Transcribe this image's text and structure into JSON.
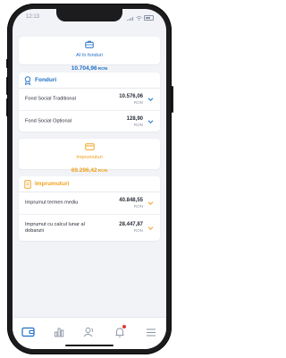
{
  "colors": {
    "blue": "#1f6fc5",
    "orange": "#f0a21e",
    "red": "#e53935",
    "text": "#2a2f3a",
    "muted": "#8a93a6"
  },
  "status": {
    "time": "12:13"
  },
  "fund_summary": {
    "label": "AI în fonduri",
    "amount": "10.704,96",
    "currency": "RON",
    "icon": "briefcase-icon"
  },
  "funds": {
    "title": "Fonduri",
    "icon": "ribbon-badge-icon",
    "rows": [
      {
        "name": "Fond Social Traditional",
        "amount": "10.576,06",
        "currency": "RON"
      },
      {
        "name": "Fond Social Optional",
        "amount": "128,90",
        "currency": "RON"
      }
    ]
  },
  "loan_summary": {
    "label": "Imprumuturi",
    "amount": "69.296,42",
    "currency": "RON",
    "icon": "wallet-card-icon"
  },
  "loans": {
    "title": "Imprumuturi",
    "icon": "document-icon",
    "rows": [
      {
        "name": "Imprumut termen mediu",
        "amount": "40.848,55",
        "currency": "RON"
      },
      {
        "name": "Imprumut cu calcul lunar al dobanzii",
        "amount": "28.447,87",
        "currency": "RON"
      }
    ]
  },
  "tabs": [
    {
      "icon": "wallet-icon",
      "active": true
    },
    {
      "icon": "bar-chart-icon",
      "active": false
    },
    {
      "icon": "users-icon",
      "active": false
    },
    {
      "icon": "bell-icon",
      "active": false,
      "badge": true
    },
    {
      "icon": "menu-icon",
      "active": false
    }
  ]
}
